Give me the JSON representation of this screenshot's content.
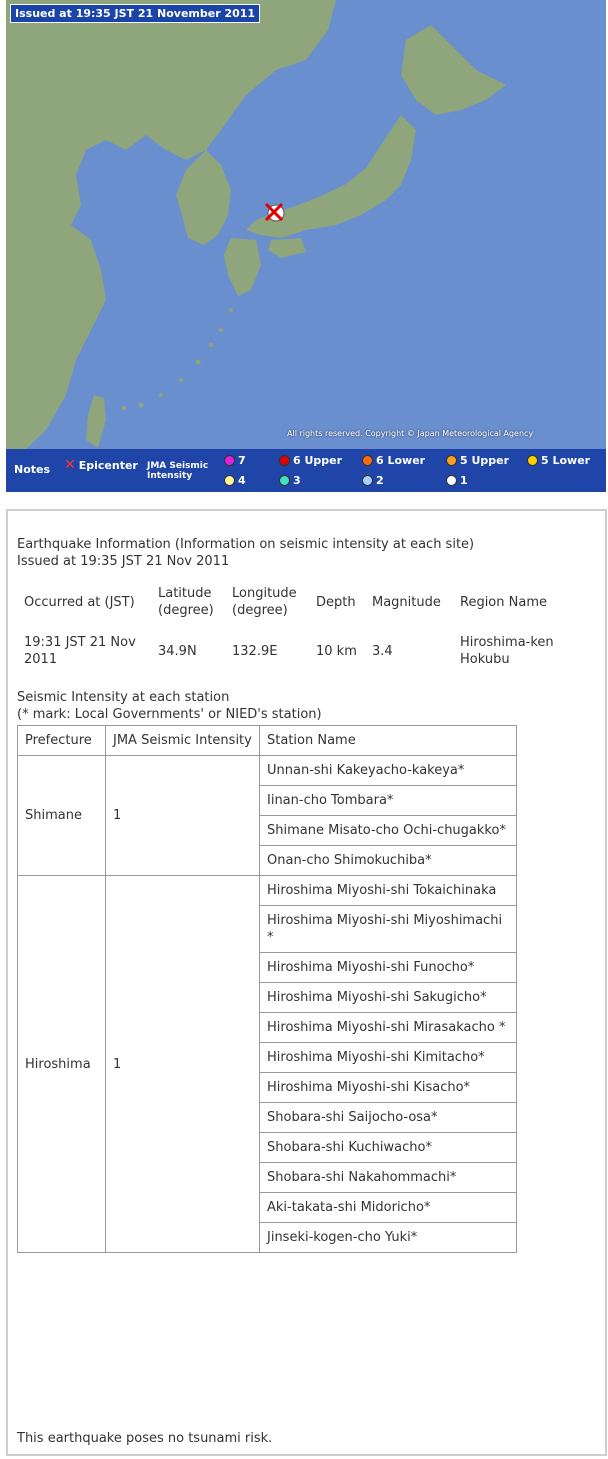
{
  "map": {
    "issued": "Issued at 19:35 JST  21 November 2011",
    "copyright": "All rights reserved. Copyright © Japan Meteorological Agency",
    "colors": {
      "sea": "#6a8fcf",
      "land": "#8fa57c",
      "legend_bg": "#1f45a8"
    }
  },
  "legend": {
    "notes": "Notes",
    "epicenter": "Epicenter",
    "intensity_line1": "JMA Seismic",
    "intensity_line2": "Intensity",
    "levels": [
      {
        "label": "7",
        "color": "#e020e0"
      },
      {
        "label": "6 Upper",
        "color": "#e00000"
      },
      {
        "label": "6 Lower",
        "color": "#ff6a10"
      },
      {
        "label": "5 Upper",
        "color": "#ffa020"
      },
      {
        "label": "5 Lower",
        "color": "#ffd000"
      },
      {
        "label": "4",
        "color": "#fff4a0"
      },
      {
        "label": "3",
        "color": "#40e0c0"
      },
      {
        "label": "2",
        "color": "#a8d0ff"
      },
      {
        "label": "1",
        "color": "#ffffff"
      }
    ]
  },
  "info": {
    "title": "Earthquake Information (Information on seismic intensity at each site)",
    "issued": "Issued at 19:35 JST 21 Nov 2011",
    "summary": {
      "headers": [
        "Occurred at (JST)",
        "Latitude (degree)",
        "Longitude (degree)",
        "Depth",
        "Magnitude",
        "Region Name"
      ],
      "values": [
        "19:31 JST 21 Nov 2011",
        "34.9N",
        "132.9E",
        "10 km",
        "3.4",
        "Hiroshima-ken Hokubu"
      ]
    },
    "section_title": "Seismic Intensity at each station",
    "section_note": "(* mark: Local Governments' or NIED's station)",
    "table_headers": [
      "Prefecture",
      "JMA Seismic Intensity",
      "Station Name"
    ],
    "groups": [
      {
        "prefecture": "Shimane",
        "intensity": "1",
        "stations": [
          "Unnan-shi Kakeyacho-kakeya*",
          "Iinan-cho Tombara*",
          "Shimane Misato-cho Ochi-chugakko*",
          "Onan-cho Shimokuchiba*"
        ]
      },
      {
        "prefecture": "Hiroshima",
        "intensity": "1",
        "stations": [
          "Hiroshima Miyoshi-shi Tokaichinaka",
          "Hiroshima Miyoshi-shi Miyoshimachi *",
          "Hiroshima Miyoshi-shi Funocho*",
          "Hiroshima Miyoshi-shi Sakugicho*",
          "Hiroshima Miyoshi-shi Mirasakacho *",
          "Hiroshima Miyoshi-shi Kimitacho*",
          "Hiroshima Miyoshi-shi Kisacho*",
          "Shobara-shi Saijocho-osa*",
          "Shobara-shi Kuchiwacho*",
          "Shobara-shi Nakahommachi*",
          "Aki-takata-shi Midoricho*",
          "Jinseki-kogen-cho Yuki*"
        ]
      }
    ],
    "tsunami": "This earthquake poses no tsunami risk."
  }
}
